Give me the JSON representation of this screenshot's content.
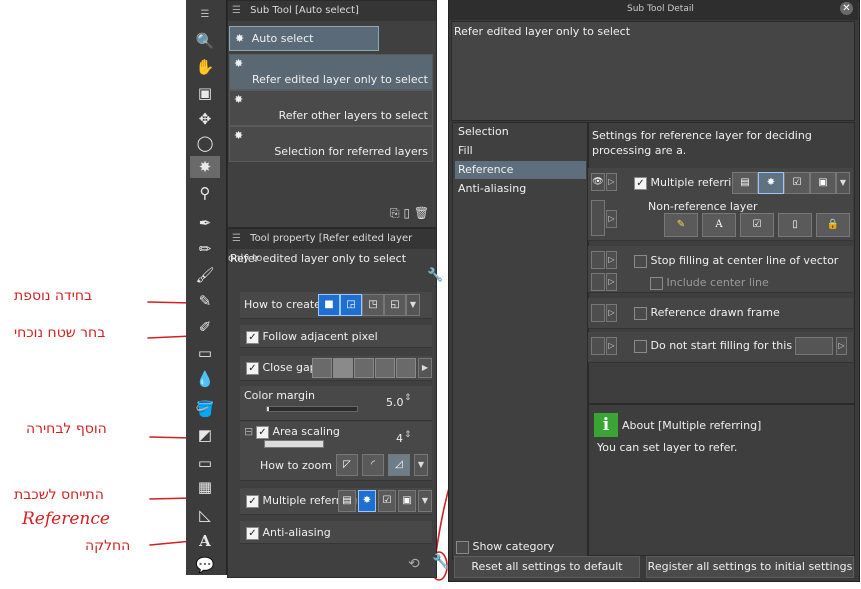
{
  "annotations": {
    "add_selection": "בחידה נוספת",
    "select_area": "בחר שטח נוכחי",
    "add_to_selection": "הוסף לבחירה",
    "reference_relation": "התייחס לשכבת",
    "reference_word": "Reference",
    "smoothing": "החלקה"
  },
  "sub_tool_panel": {
    "title": "Sub Tool [Auto select]",
    "group_label": "Auto select",
    "items": [
      {
        "label": "Refer edited layer only to select"
      },
      {
        "label": "Refer other layers to select"
      },
      {
        "label": "Selection for referred layers"
      }
    ]
  },
  "tool_property": {
    "title": "Tool property [Refer edited layer only to",
    "preview_text": "Refer edited layer only to select",
    "how_to_create": "How to create",
    "follow_adjacent": "Follow adjacent pixel",
    "close_gap": "Close gap",
    "color_margin": "Color margin",
    "color_margin_value": "5.0",
    "color_margin_fraction": 0.02,
    "area_scaling": "Area scaling",
    "area_scaling_value": "4",
    "how_to_zoom": "How to zoom",
    "multiple_referring": "Multiple referring",
    "anti_aliasing": "Anti-aliasing"
  },
  "detail": {
    "title": "Sub Tool Detail",
    "preview_text": "Refer edited layer only to select",
    "categories": [
      "Selection",
      "Fill",
      "Reference",
      "Anti-aliasing"
    ],
    "selected_category": "Reference",
    "section_text": "Settings for reference layer for deciding processing are a.",
    "multiple_referring": "Multiple referring",
    "non_reference_layer": "Non-reference layer",
    "stop_filling": "Stop filling at center line of vector",
    "include_center": "Include center line",
    "reference_frame": "Reference drawn frame",
    "do_not_start": "Do not start filling for this color",
    "about_title": "About [Multiple referring]",
    "about_text": "You can set layer to refer.",
    "show_category": "Show category",
    "reset_button": "Reset all settings to default",
    "register_button": "Register all settings to initial settings"
  },
  "icons": {
    "accent": "#1e6fd0",
    "annotation_color": "#d42020",
    "info_icon_color": "#3aa535"
  }
}
